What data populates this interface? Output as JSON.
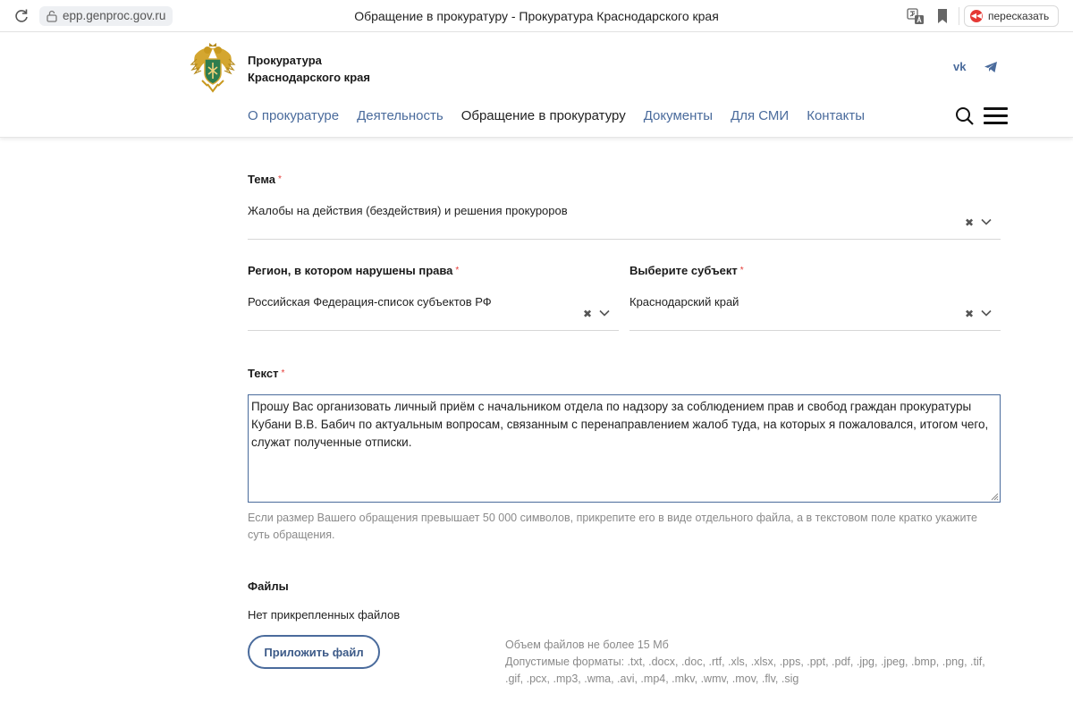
{
  "browser": {
    "url": "epp.genproc.gov.ru",
    "tab_title": "Обращение в прокуратуру - Прокуратура Краснодарского края",
    "retell_label": "пересказать"
  },
  "header": {
    "org_line1": "Прокуратура",
    "org_line2": "Краснодарского края",
    "social": {
      "vk": "vk"
    },
    "nav": [
      {
        "label": "О прокуратуре"
      },
      {
        "label": "Деятельность"
      },
      {
        "label": "Обращение в прокуратуру"
      },
      {
        "label": "Документы"
      },
      {
        "label": "Для СМИ"
      },
      {
        "label": "Контакты"
      }
    ],
    "active_nav_index": 2
  },
  "form": {
    "topic": {
      "label": "Тема",
      "value": "Жалобы на действия (бездействия) и решения прокуроров"
    },
    "region": {
      "label": "Регион, в котором нарушены права",
      "value": "Российская Федерация-список субъектов РФ"
    },
    "subject": {
      "label": "Выберите субъект",
      "value": "Краснодарский край"
    },
    "text": {
      "label": "Текст",
      "value": "Прошу Вас организовать личный приём с начальником отдела по надзору за соблюдением прав и свобод граждан прокуратуры Кубани В.В. Бабич по актуальным вопросам, связанным с перенаправлением жалоб туда, на которых я пожаловался, итогом чего, служат полученные отписки.",
      "hint": "Если размер Вашего обращения превышает 50 000 символов, прикрепите его в виде отдельного файла, а в текстовом поле кратко укажите суть обращения."
    },
    "required_mark": "*",
    "files": {
      "label": "Файлы",
      "empty": "Нет прикрепленных файлов",
      "attach_button": "Приложить файл",
      "size_note": "Объем файлов не более 15 Мб",
      "formats_note": "Допустимые форматы: .txt, .docx, .doc, .rtf, .xls, .xlsx, .pps, .ppt, .pdf, .jpg, .jpeg, .bmp, .png, .tif, .gif, .pcx, .mp3, .wma, .avi, .mp4, .mkv, .wmv, .mov, .flv, .sig"
    }
  },
  "colors": {
    "link": "#4a6b9c",
    "required": "#e53935",
    "hint": "#8a8a8a"
  },
  "icons": [
    "reload-icon",
    "lock-icon",
    "translate-icon",
    "bookmark-icon",
    "emblem-icon",
    "vk-icon",
    "telegram-icon",
    "search-icon",
    "menu-icon",
    "clear-icon",
    "chevron-down-icon"
  ]
}
